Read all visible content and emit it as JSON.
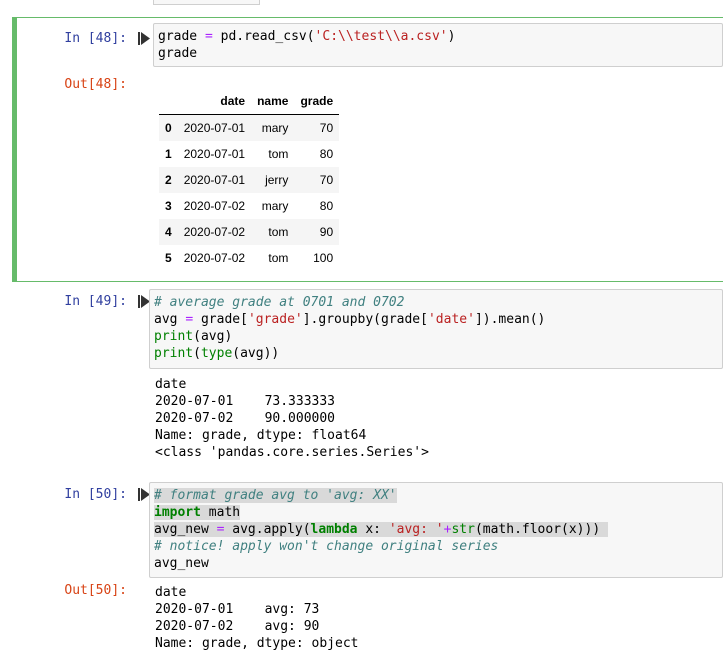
{
  "cells": [
    {
      "prompt_in": "In [48]:",
      "code": [
        [
          {
            "t": "grade ",
            "c": ""
          },
          {
            "t": "=",
            "c": "o"
          },
          {
            "t": " pd.read_csv(",
            "c": ""
          },
          {
            "t": "'C:\\\\test\\\\a.csv'",
            "c": "s"
          },
          {
            "t": ")",
            "c": ""
          }
        ],
        [
          {
            "t": "grade",
            "c": ""
          }
        ]
      ],
      "prompt_out": "Out[48]:",
      "table": {
        "columns": [
          "",
          "date",
          "name",
          "grade"
        ],
        "rows": [
          {
            "index": "0",
            "date": "2020-07-01",
            "name": "mary",
            "grade": "70"
          },
          {
            "index": "1",
            "date": "2020-07-01",
            "name": "tom",
            "grade": "80"
          },
          {
            "index": "2",
            "date": "2020-07-01",
            "name": "jerry",
            "grade": "70"
          },
          {
            "index": "3",
            "date": "2020-07-02",
            "name": "mary",
            "grade": "80"
          },
          {
            "index": "4",
            "date": "2020-07-02",
            "name": "tom",
            "grade": "90"
          },
          {
            "index": "5",
            "date": "2020-07-02",
            "name": "tom",
            "grade": "100"
          }
        ]
      }
    },
    {
      "prompt_in": "In [49]:",
      "code": [
        [
          {
            "t": "# average grade at 0701 and 0702",
            "c": "c"
          }
        ],
        [
          {
            "t": "avg ",
            "c": ""
          },
          {
            "t": "=",
            "c": "o"
          },
          {
            "t": " grade[",
            "c": ""
          },
          {
            "t": "'grade'",
            "c": "s"
          },
          {
            "t": "].groupby(grade[",
            "c": ""
          },
          {
            "t": "'date'",
            "c": "s"
          },
          {
            "t": "]).mean()",
            "c": ""
          }
        ],
        [
          {
            "t": "print",
            "c": "b"
          },
          {
            "t": "(avg)",
            "c": ""
          }
        ],
        [
          {
            "t": "print",
            "c": "b"
          },
          {
            "t": "(",
            "c": ""
          },
          {
            "t": "type",
            "c": "b"
          },
          {
            "t": "(avg))",
            "c": ""
          }
        ]
      ],
      "stdout": [
        "date",
        "2020-07-01    73.333333",
        "2020-07-02    90.000000",
        "Name: grade, dtype: float64",
        "<class 'pandas.core.series.Series'>"
      ]
    },
    {
      "prompt_in": "In [50]:",
      "code": [
        [
          {
            "t": "# format grade avg to 'avg: XX'",
            "c": "c"
          }
        ],
        [
          {
            "t": "import",
            "c": "k"
          },
          {
            "t": " math",
            "c": ""
          }
        ],
        [
          {
            "t": "avg_new ",
            "c": ""
          },
          {
            "t": "=",
            "c": "o"
          },
          {
            "t": " avg.apply(",
            "c": ""
          },
          {
            "t": "lambda",
            "c": "k"
          },
          {
            "t": " x: ",
            "c": ""
          },
          {
            "t": "'avg: '",
            "c": "s"
          },
          {
            "t": "+",
            "c": "o"
          },
          {
            "t": "str",
            "c": "b"
          },
          {
            "t": "(math.floor(x)))",
            "c": ""
          }
        ],
        [
          {
            "t": "# notice! apply won't change original series",
            "c": "c"
          }
        ],
        [
          {
            "t": "avg_new",
            "c": ""
          }
        ]
      ],
      "prompt_out": "Out[50]:",
      "result": [
        "date",
        "2020-07-01    avg: 73",
        "2020-07-02    avg: 90",
        "Name: grade, dtype: object"
      ]
    }
  ],
  "icons": {
    "run": "run-cell-icon"
  },
  "colors": {
    "selected_border": "#66bb6a",
    "prompt_in": "#303f9f",
    "prompt_out": "#d84315"
  }
}
